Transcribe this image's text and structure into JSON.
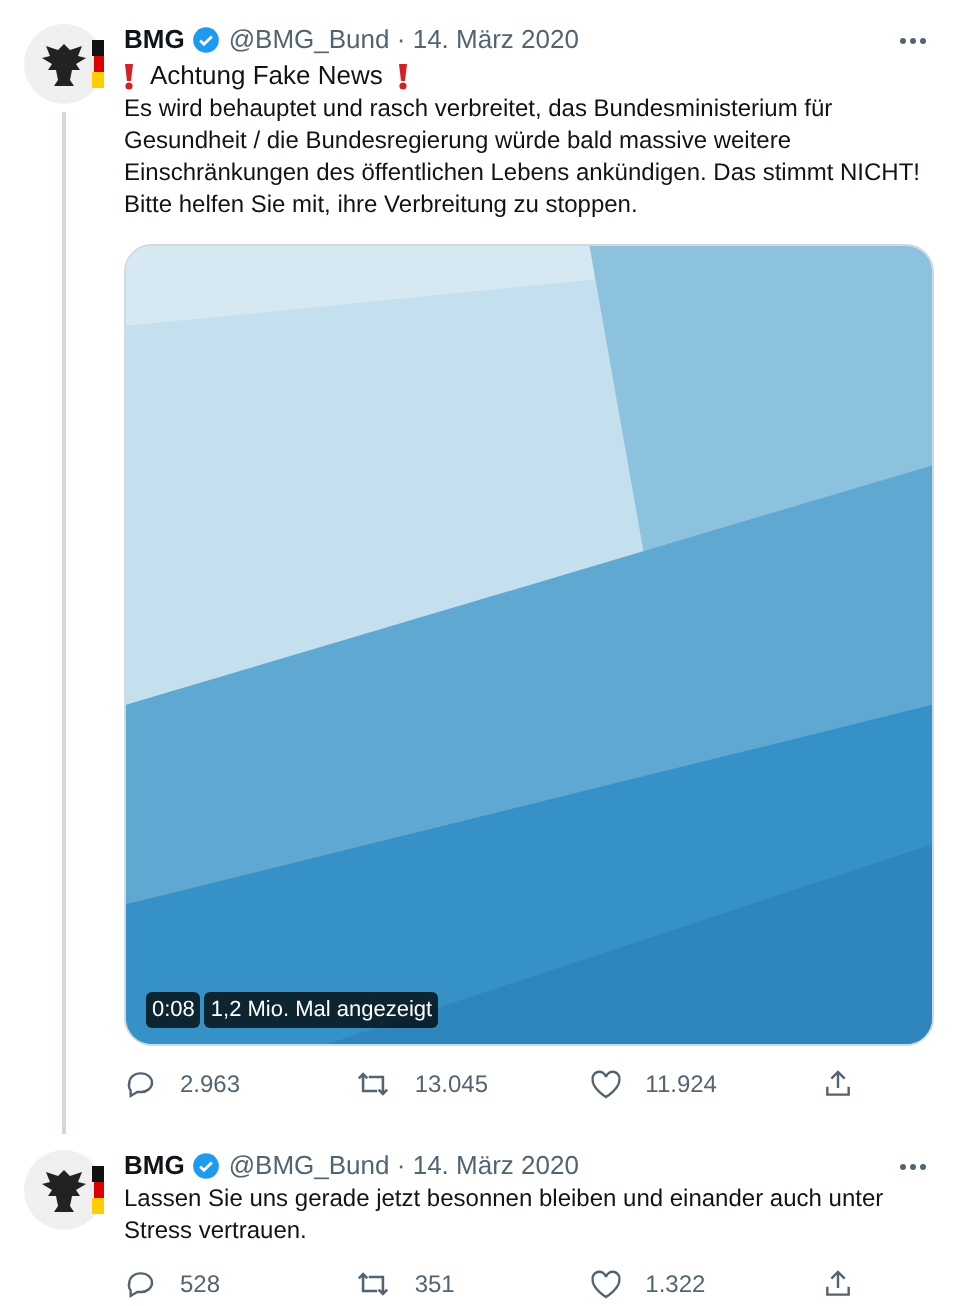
{
  "tweets": [
    {
      "name": "BMG",
      "verified": true,
      "handle": "@BMG_Bund",
      "separator": "·",
      "date": "14. März 2020",
      "alert_title": "Achtung Fake News",
      "text": "Es wird behauptet und rasch verbreitet, das Bundesministerium für Gesundheit / die Bundesregierung würde bald massive weitere Einschränkungen des öffentlichen Lebens ankündigen. Das stimmt NICHT! Bitte helfen Sie mit, ihre Verbreitung zu stoppen.",
      "media": {
        "kind": "picture",
        "duration": "0:08",
        "views": "1,2 Mio. Mal angezeigt"
      },
      "thread_line": true,
      "replies": "2.963",
      "retweets": "13.045",
      "likes": "11.924"
    },
    {
      "name": "BMG",
      "verified": true,
      "handle": "@BMG_Bund",
      "separator": "·",
      "date": "14. März 2020",
      "text": "Lassen Sie uns gerade jetzt besonnen bleiben und einander auch unter Stress vertrauen.",
      "thread_line": false,
      "replies": "528",
      "retweets": "351",
      "likes": "1.322"
    }
  ]
}
